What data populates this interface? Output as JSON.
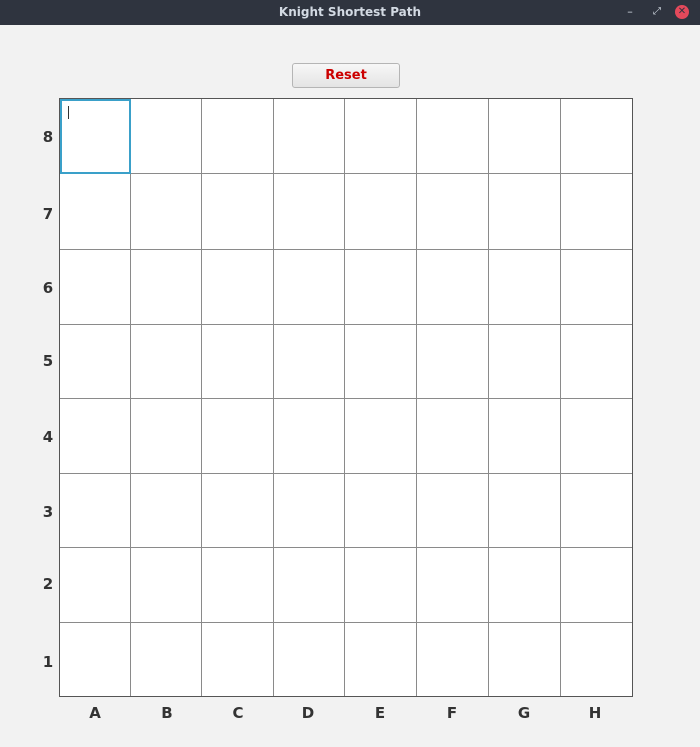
{
  "window": {
    "title": "Knight Shortest Path",
    "minimize_icon": "minimize-icon",
    "maximize_icon": "maximize-icon",
    "close_icon": "close-icon"
  },
  "toolbar": {
    "reset_label": "Reset"
  },
  "board": {
    "files": [
      "A",
      "B",
      "C",
      "D",
      "E",
      "F",
      "G",
      "H"
    ],
    "ranks": [
      "8",
      "7",
      "6",
      "5",
      "4",
      "3",
      "2",
      "1"
    ],
    "focused_cell": "A8",
    "colors": {
      "focus_border": "#3aa0c9",
      "reset_text": "#cc0000",
      "titlebar": "#2f343f"
    }
  }
}
